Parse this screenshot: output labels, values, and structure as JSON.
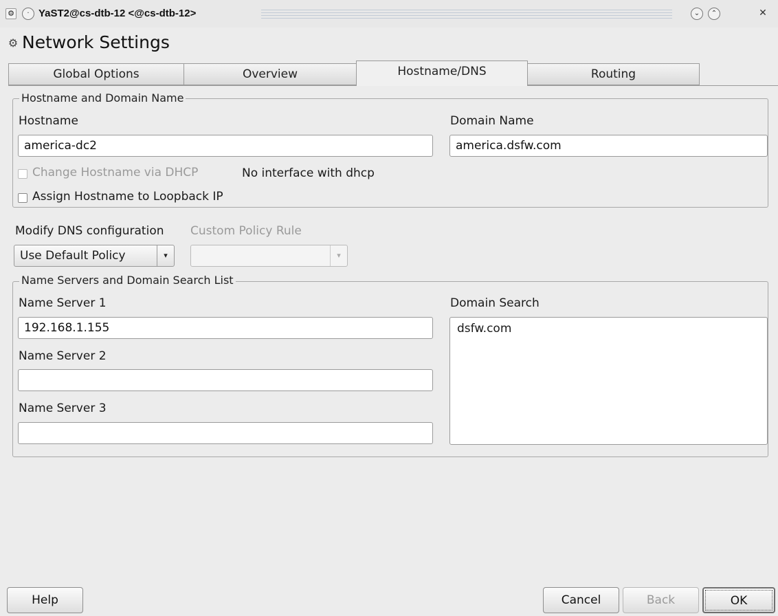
{
  "window": {
    "title": "YaST2@cs-dtb-12 <@cs-dtb-12>",
    "minimize_glyph": "⌄",
    "maximize_glyph": "⌃",
    "close_glyph": "✕"
  },
  "page_title": "Network Settings",
  "tabs": [
    {
      "label": "Global Options",
      "active": false
    },
    {
      "label": "Overview",
      "active": false
    },
    {
      "label": "Hostname/DNS",
      "active": true
    },
    {
      "label": "Routing",
      "active": false
    }
  ],
  "hostname_group": {
    "title": "Hostname and Domain Name",
    "hostname_label": "Hostname",
    "hostname_value": "america-dc2",
    "domain_label": "Domain Name",
    "domain_value": "america.dsfw.com",
    "dhcp_checkbox_label": "Change Hostname via DHCP",
    "dhcp_note": "No interface with dhcp",
    "loopback_checkbox_label": "Assign Hostname to Loopback IP"
  },
  "dns_config": {
    "modify_label": "Modify DNS configuration",
    "modify_value": "Use Default Policy",
    "custom_label": "Custom Policy Rule",
    "custom_value": ""
  },
  "nameserver_group": {
    "title": "Name Servers and Domain Search List",
    "ns1_label": "Name Server 1",
    "ns1_value": "192.168.1.155",
    "ns2_label": "Name Server 2",
    "ns2_value": "",
    "ns3_label": "Name Server 3",
    "ns3_value": "",
    "domain_search_label": "Domain Search",
    "domain_search_items": [
      "dsfw.com"
    ]
  },
  "buttons": {
    "help": "Help",
    "cancel": "Cancel",
    "back": "Back",
    "ok": "OK"
  },
  "icons": {
    "app_icon": "yast-network-icon",
    "combo_arrow": "▾"
  }
}
